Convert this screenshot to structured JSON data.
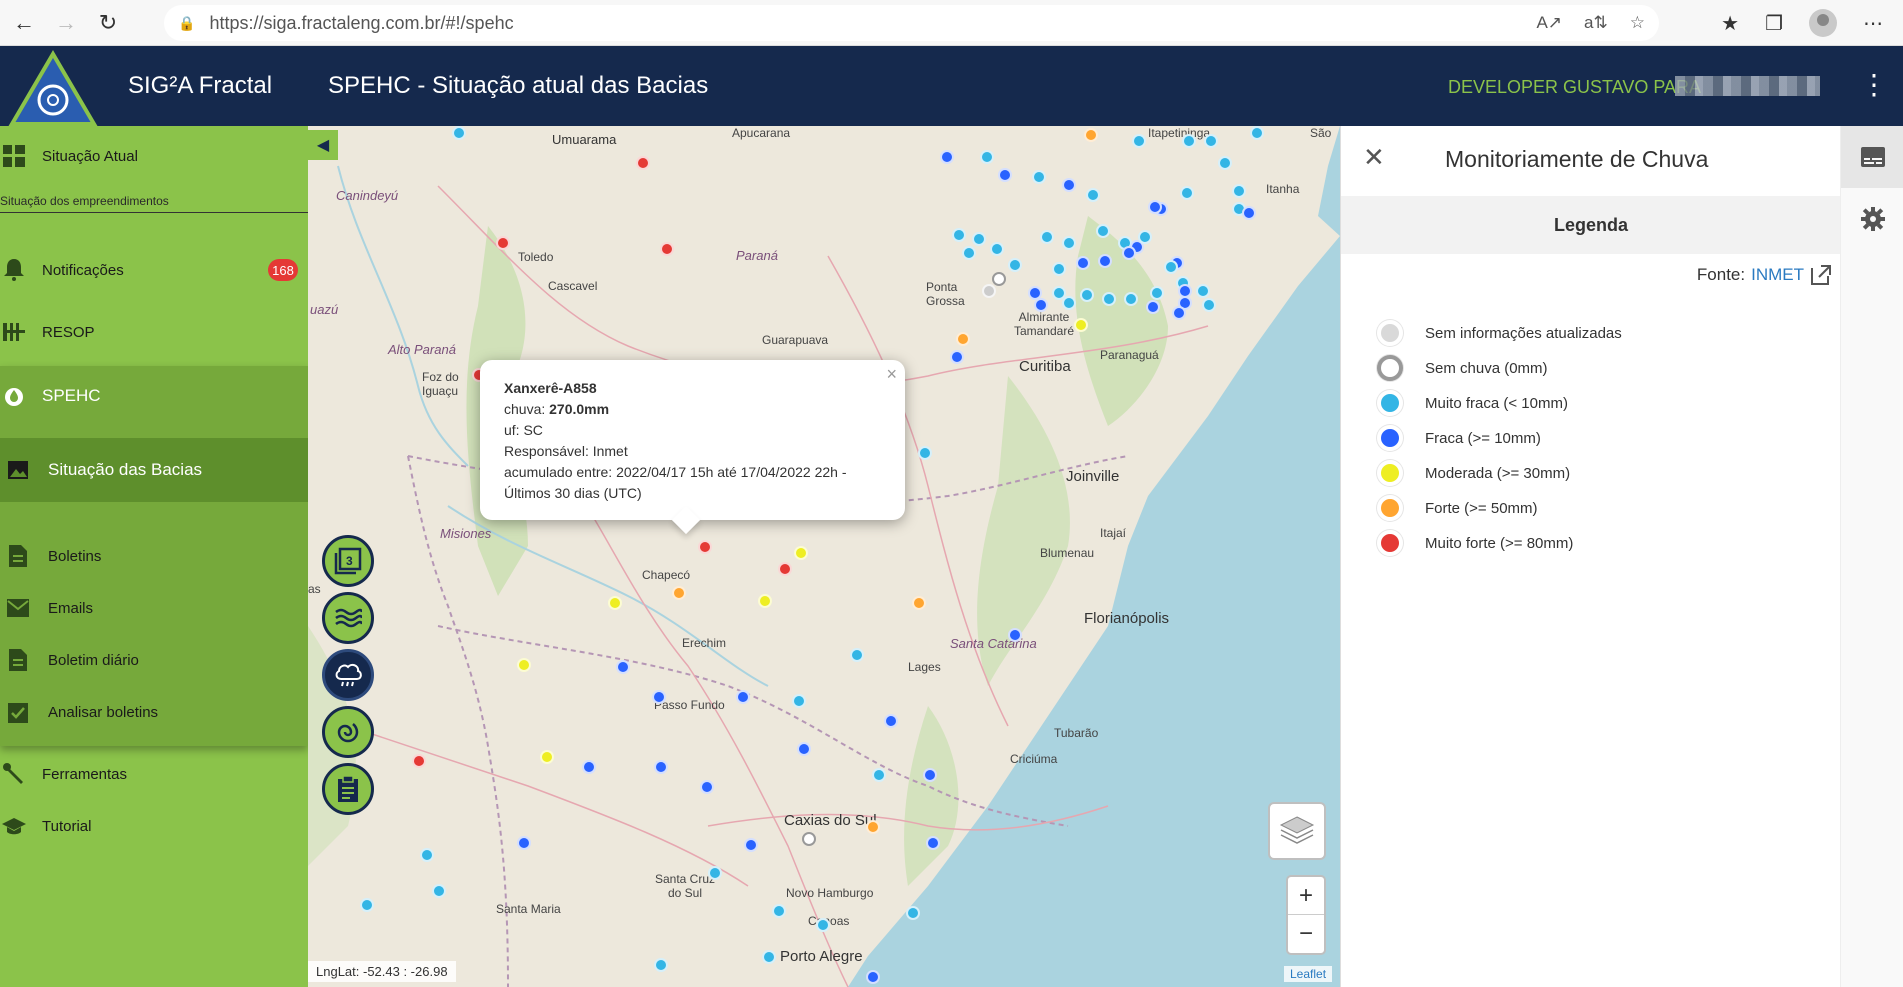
{
  "browser": {
    "url": "https://siga.fractaleng.com.br/#!/spehc"
  },
  "header": {
    "app_title": "SIG²A Fractal",
    "page_title": "SPEHC - Situação atual das Bacias",
    "user": "DEVELOPER GUSTAVO PARA"
  },
  "sidebar": {
    "situacao_atual": "Situação Atual",
    "subtitle": "Situação dos empreendimentos",
    "notificacoes": "Notificações",
    "notificacoes_badge": "168",
    "resop": "RESOP",
    "spehc": "SPEHC",
    "situacao_bacias": "Situação das Bacias",
    "boletins": "Boletins",
    "emails": "Emails",
    "boletim_diario": "Boletim diário",
    "analisar_boletins": "Analisar boletins",
    "ferramentas": "Ferramentas",
    "tutorial": "Tutorial"
  },
  "map": {
    "labels": {
      "apucarana": "Apucarana",
      "umuarama": "Umuarama",
      "caninde": "Canindeyú",
      "toledo": "Toledo",
      "cascavel": "Cascavel",
      "parana": "Paraná",
      "alto_parana": "Alto Paraná",
      "foz": "Foz do Iguaçu",
      "guarapuava": "Guarapuava",
      "ponta_grossa": "Ponta Grossa",
      "almirante": "Almirante Tamandaré",
      "curitiba": "Curitiba",
      "paranagua": "Paranaguá",
      "itapetininga": "Itapetininga",
      "itanhaem": "Itanha",
      "sao": "São",
      "joinville": "Joinville",
      "itajai": "Itajaí",
      "blumenau": "Blumenau",
      "misiones": "Misiones",
      "chapeco": "Chapecó",
      "erechim": "Erechim",
      "lages": "Lages",
      "santa_catarina": "Santa Catarina",
      "florianopolis": "Florianópolis",
      "passo_fundo": "Passo Fundo",
      "tubarao": "Tubarão",
      "criciuma": "Criciúma",
      "caxias": "Caxias do Sul",
      "santa_cruz": "Santa Cruz do Sul",
      "novo_hamburgo": "Novo Hamburgo",
      "canoas": "Canoas",
      "porto_alegre": "Porto Alegre",
      "santa_maria": "Santa Maria",
      "uza": "uazú",
      "as": "as"
    },
    "popup": {
      "station": "Xanxerê-A858",
      "chuva_label": "chuva:",
      "chuva_value": "270.0mm",
      "uf": "uf: SC",
      "responsavel": "Responsável: Inmet",
      "acumulado": "acumulado entre: 2022/04/17 15h até 17/04/2022 22h -",
      "periodo": "Últimos 30 dias (UTC)",
      "close": "×"
    },
    "lnglat": "LngLat: -52.43 : -26.98",
    "attribution": "Leaflet",
    "zoom_in": "+",
    "zoom_out": "−"
  },
  "panel": {
    "title": "Monitoriamente de Chuva",
    "legend_header": "Legenda",
    "fonte_label": "Fonte:",
    "fonte_link": "INMET",
    "legend": [
      {
        "label": "Sem informações atualizadas",
        "color": "#d9d9d9"
      },
      {
        "label": "Sem chuva (0mm)",
        "color": "#ffffff"
      },
      {
        "label": "Muito fraca (< 10mm)",
        "color": "#33b5e5"
      },
      {
        "label": "Fraca (>= 10mm)",
        "color": "#2962ff"
      },
      {
        "label": "Moderada (>= 30mm)",
        "color": "#eeee22"
      },
      {
        "label": "Forte (>= 50mm)",
        "color": "#ffa530"
      },
      {
        "label": "Muito forte (>= 80mm)",
        "color": "#e53935"
      }
    ]
  }
}
